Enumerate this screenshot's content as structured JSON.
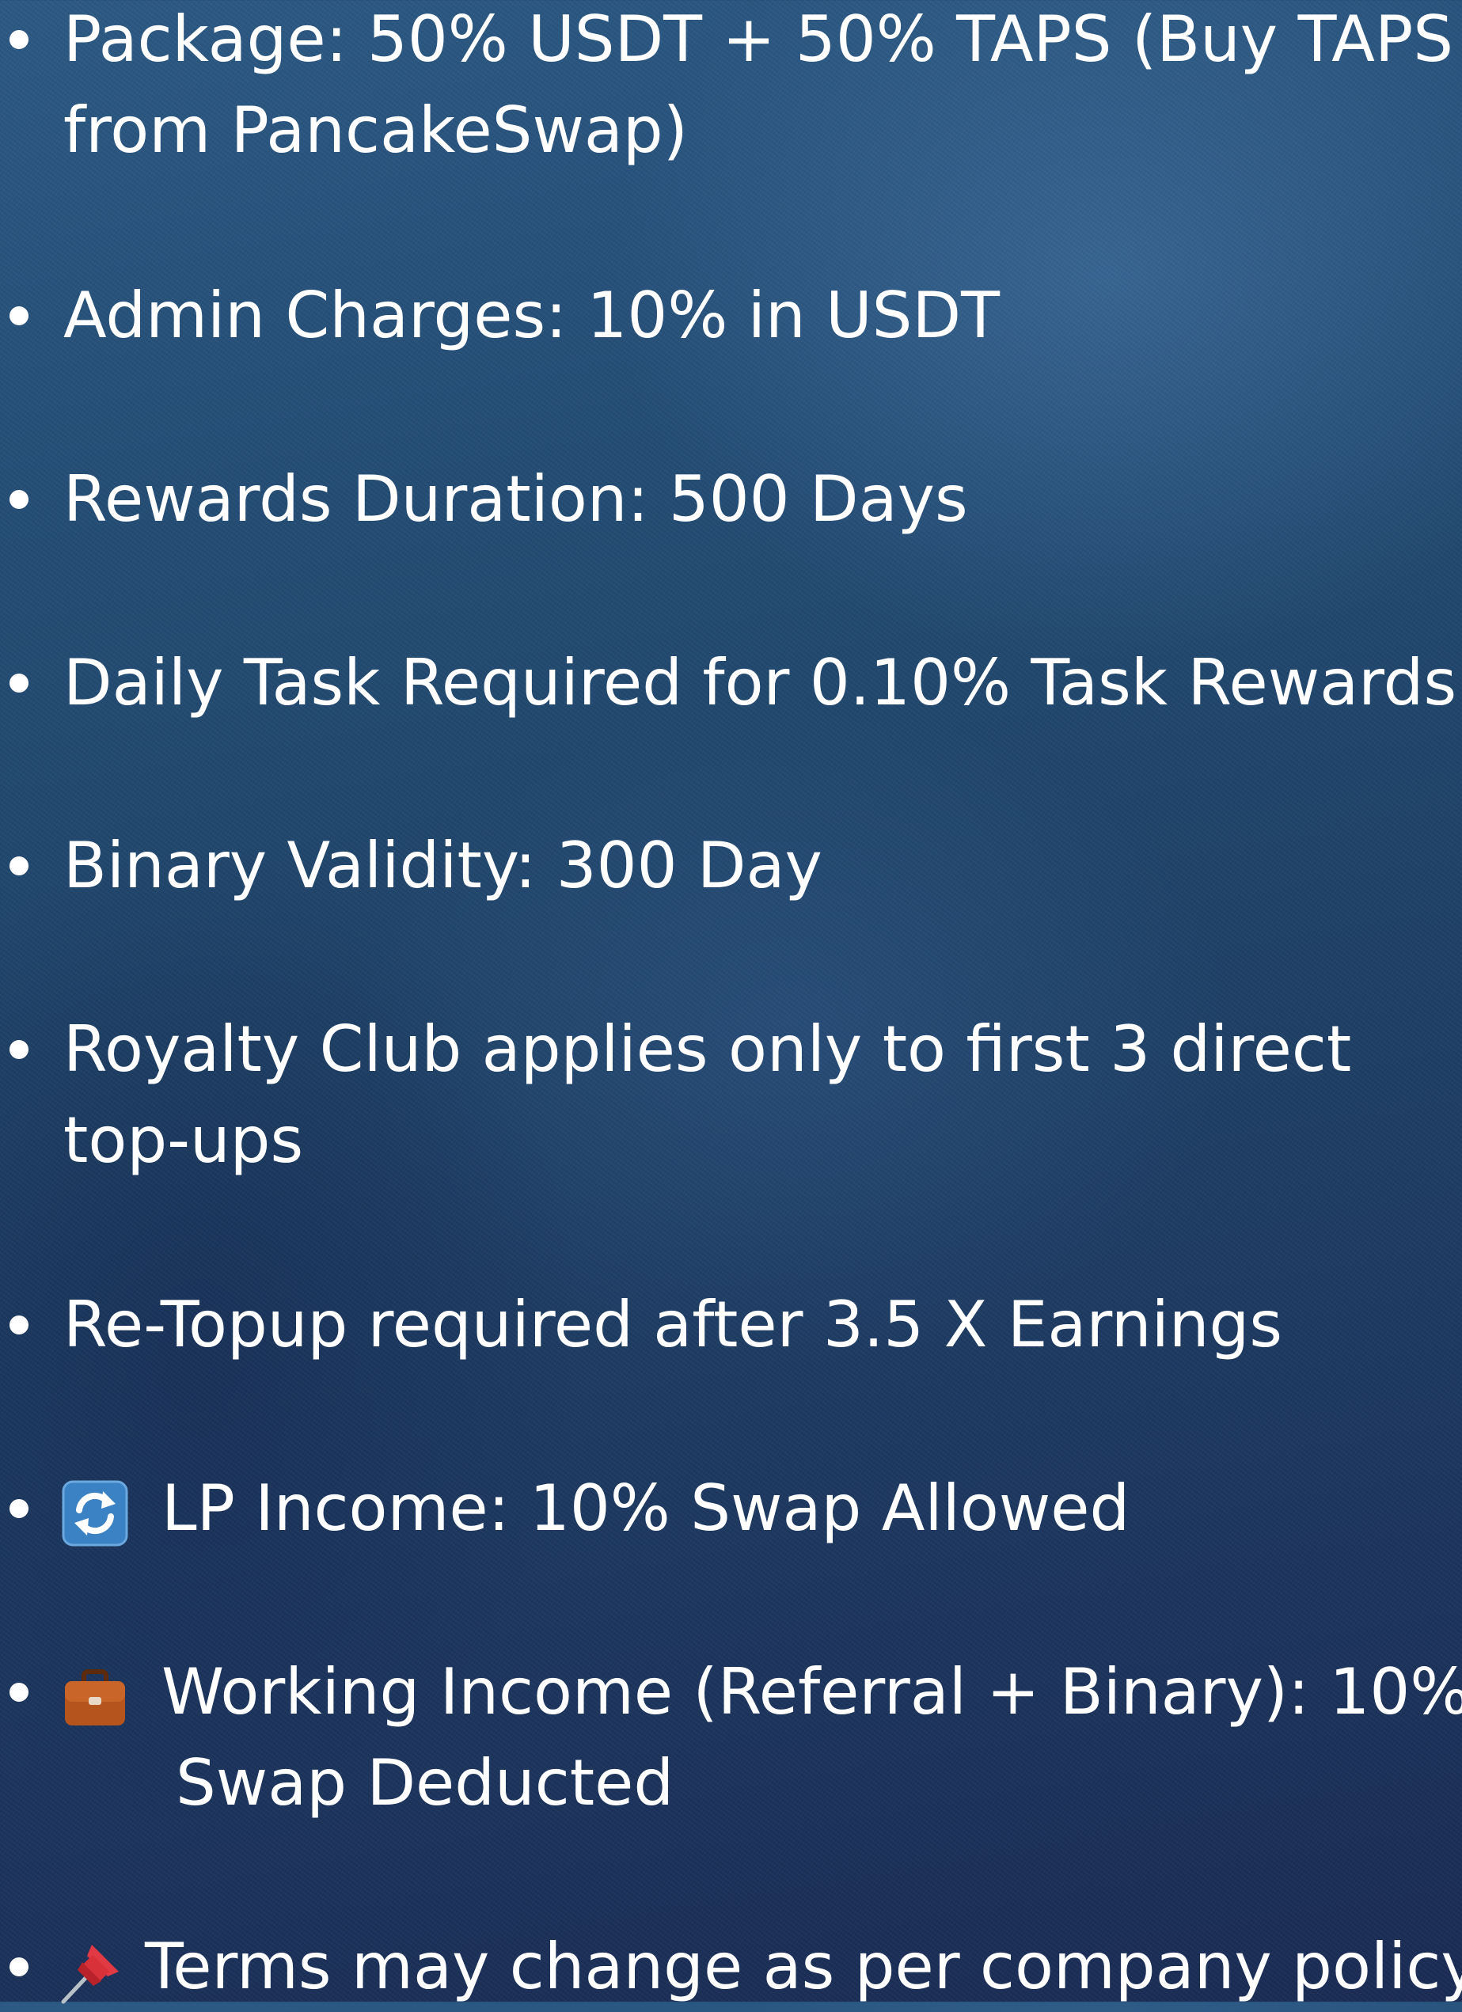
{
  "items": [
    {
      "line1": "Package: 50% USDT + 50% TAPS (Buy TAPS",
      "line2": "from PancakeSwap)"
    },
    {
      "line1": "Admin Charges: 10% in USDT"
    },
    {
      "line1": "Rewards Duration: 500 Days"
    },
    {
      "line1": "Daily Task Required for 0.10% Task Rewards"
    },
    {
      "line1": "Binary Validity: 300 Day"
    },
    {
      "line1": "Royalty Club applies only to first 3 direct",
      "line2": "top-ups"
    },
    {
      "line1": "Re-Topup required after 3.5 X Earnings"
    },
    {
      "icon": "arrows-cycle-icon",
      "line1": "LP Income:  10% Swap Allowed"
    },
    {
      "icon": "briefcase-icon",
      "line1": "Working Income (Referral + Binary): 10%",
      "line2": "Swap Deducted"
    },
    {
      "icon": "pushpin-icon",
      "line1": "Terms may change as per company policy"
    }
  ],
  "colors": {
    "text": "#ffffff",
    "background_top": "#2c5a85",
    "background_bottom": "#1a2c55",
    "cycle_icon": "#3b82c4",
    "briefcase_icon": "#b5541c",
    "pin_icon": "#d9313a"
  }
}
